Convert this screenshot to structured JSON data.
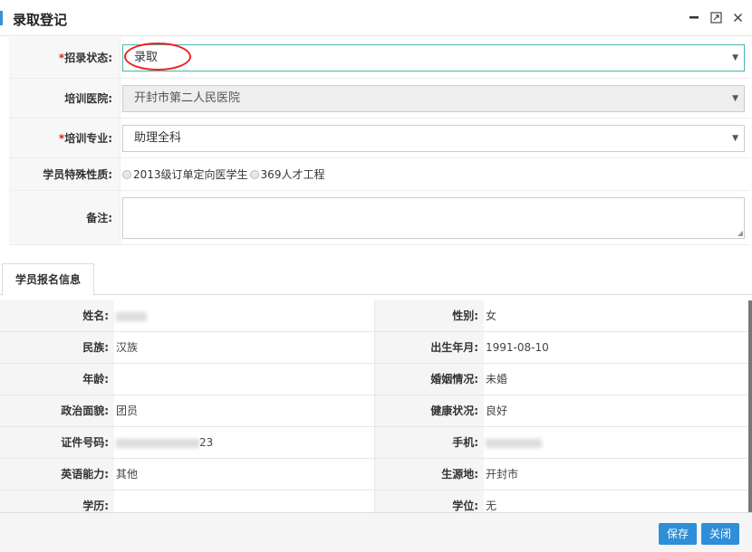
{
  "dialog": {
    "title": "录取登记"
  },
  "form": {
    "status": {
      "label": "招录状态:",
      "value": "录取"
    },
    "hospital": {
      "label": "培训医院:",
      "value": "开封市第二人民医院"
    },
    "major": {
      "label": "培训专业:",
      "value": "助理全科"
    },
    "special": {
      "label": "学员特殊性质:",
      "options": [
        "2013级订单定向医学生",
        "369人才工程"
      ]
    },
    "remark": {
      "label": "备注:",
      "value": ""
    }
  },
  "tab": {
    "label": "学员报名信息"
  },
  "info": {
    "name": {
      "label": "姓名:",
      "value": ""
    },
    "gender": {
      "label": "性别:",
      "value": "女"
    },
    "ethnicity": {
      "label": "民族:",
      "value": "汉族"
    },
    "birth": {
      "label": "出生年月:",
      "value": "1991-08-10"
    },
    "age": {
      "label": "年龄:",
      "value": ""
    },
    "marital": {
      "label": "婚姻情况:",
      "value": "未婚"
    },
    "political": {
      "label": "政治面貌:",
      "value": "团员"
    },
    "health": {
      "label": "健康状况:",
      "value": "良好"
    },
    "idno": {
      "label": "证件号码:",
      "value": "23"
    },
    "phone": {
      "label": "手机:",
      "value": ""
    },
    "english": {
      "label": "英语能力:",
      "value": "其他"
    },
    "origin": {
      "label": "生源地:",
      "value": "开封市"
    },
    "education": {
      "label": "学历:",
      "value": ""
    },
    "degree": {
      "label": "学位:",
      "value": "无"
    }
  },
  "buttons": {
    "save": "保存",
    "close": "关闭"
  }
}
